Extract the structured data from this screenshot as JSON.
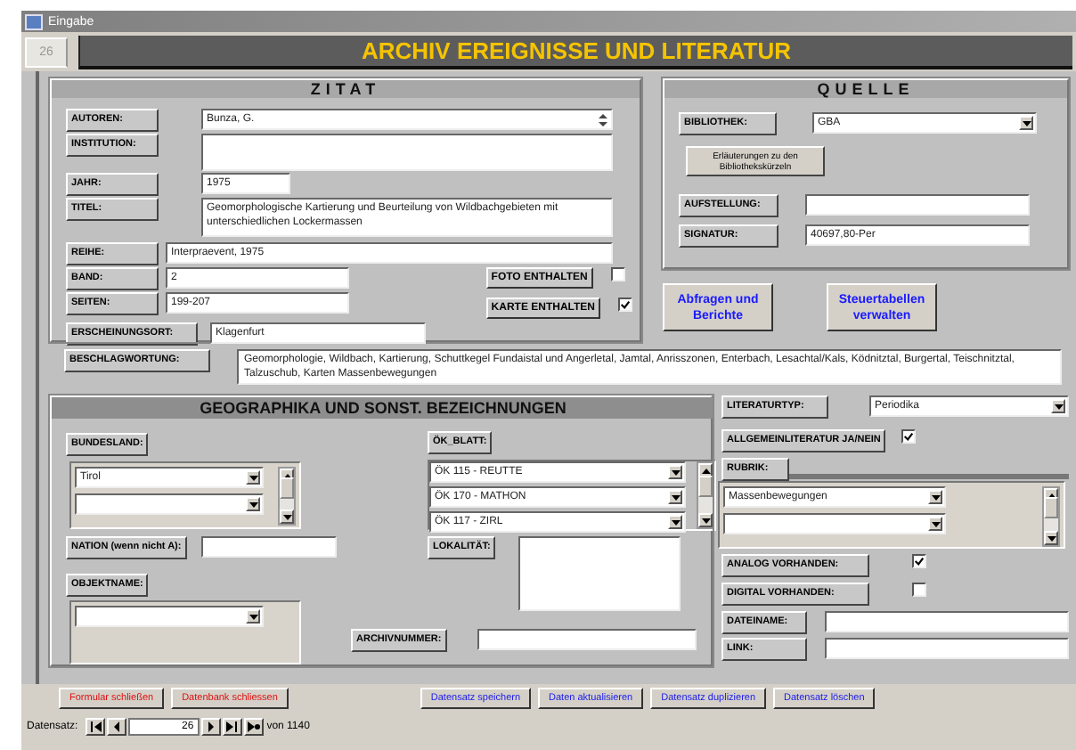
{
  "window": {
    "title": "Eingabe"
  },
  "record_tab": "26",
  "header_title": "ARCHIV EREIGNISSE UND LITERATUR",
  "zitat": {
    "title": "ZITAT",
    "autoren": {
      "label": "AUTOREN:",
      "value": "Bunza, G."
    },
    "institution": {
      "label": "INSTITUTION:"
    },
    "jahr": {
      "label": "JAHR:",
      "value": "1975"
    },
    "titel": {
      "label": "TITEL:",
      "value": "Geomorphologische Kartierung und Beurteilung von Wildbachgebieten mit unterschiedlichen Lockermassen"
    },
    "reihe": {
      "label": "REIHE:",
      "value": "Interpraevent, 1975"
    },
    "band": {
      "label": "BAND:",
      "value": "2"
    },
    "seiten": {
      "label": "SEITEN:",
      "value": "199-207"
    },
    "erscheinungsort": {
      "label": "ERSCHEINUNGSORT:",
      "value": "Klagenfurt"
    },
    "foto": {
      "label": "FOTO ENTHALTEN",
      "checked": false
    },
    "karte": {
      "label": "KARTE ENTHALTEN",
      "checked": true
    }
  },
  "quelle": {
    "title": "QUELLE",
    "bibliothek": {
      "label": "BIBLIOTHEK:",
      "value": "GBA"
    },
    "erlaeuterungen_button": "Erläuterungen zu den Bibliothekskürzeln",
    "aufstellung": {
      "label": "AUFSTELLUNG:"
    },
    "signatur": {
      "label": "SIGNATUR:",
      "value": "40697,80-Per"
    }
  },
  "action_buttons": [
    "Abfragen und Berichte",
    "Steuertabellen verwalten"
  ],
  "beschlagwortung": {
    "label": "BESCHLAGWORTUNG:",
    "value": "Geomorphologie, Wildbach, Kartierung, Schuttkegel Fundaistal und Angerletal, Jamtal, Anrisszonen, Enterbach, Lesachtal/Kals, Ködnitztal, Burgertal, Teischnitztal, Talzuschub, Karten Massenbewegungen"
  },
  "geographika": {
    "title": "GEOGRAPHIKA UND SONST. BEZEICHNUNGEN",
    "bundesland": {
      "label": "BUNDESLAND:",
      "value": "Tirol"
    },
    "nation": {
      "label": "NATION (wenn nicht A):"
    },
    "objektname": {
      "label": "OBJEKTNAME:"
    },
    "ok_blatt": {
      "label": "ÖK_BLATT:",
      "values": [
        "ÖK 115 - REUTTE",
        "ÖK 170 - MATHON",
        "ÖK 117 - ZIRL"
      ]
    },
    "lokalitaet": {
      "label": "LOKALITÄT:"
    },
    "archivnummer": {
      "label": "ARCHIVNUMMER:"
    }
  },
  "literatur": {
    "literaturtyp": {
      "label": "LITERATURTYP:",
      "value": "Periodika"
    },
    "allgemeinliteratur": {
      "label": "ALLGEMEINLITERATUR JA/NEIN",
      "checked": true
    },
    "rubrik": {
      "label": "RUBRIK:",
      "value": "Massenbewegungen"
    },
    "analog": {
      "label": "ANALOG VORHANDEN:",
      "checked": true
    },
    "digital": {
      "label": "DIGITAL VORHANDEN:",
      "checked": false
    },
    "dateiname": {
      "label": "DATEINAME:"
    },
    "link": {
      "label": "LINK:"
    }
  },
  "footer_buttons": [
    {
      "label": "Formular schließen",
      "kind": "danger"
    },
    {
      "label": "Datenbank schliessen",
      "kind": "danger"
    },
    {
      "label": "Datensatz speichern",
      "kind": "normal"
    },
    {
      "label": "Daten aktualisieren",
      "kind": "normal"
    },
    {
      "label": "Datensatz duplizieren",
      "kind": "normal"
    },
    {
      "label": "Datensatz löschen",
      "kind": "normal"
    }
  ],
  "navigator": {
    "label": "Datensatz:",
    "current": "26",
    "total": "von 1140"
  }
}
